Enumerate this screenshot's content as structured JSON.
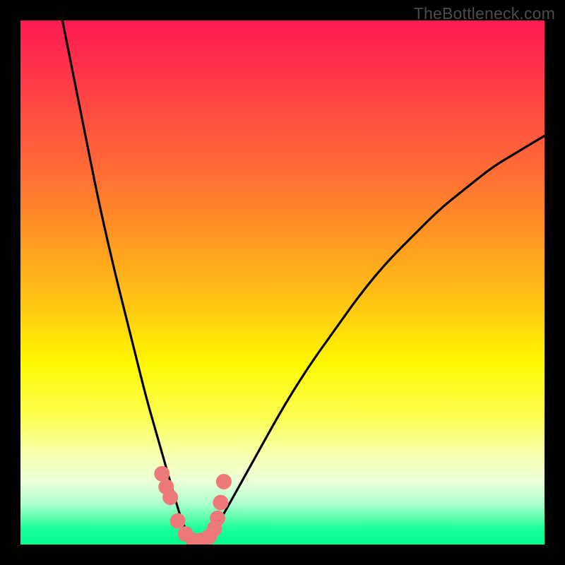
{
  "watermark": "TheBottleneck.com",
  "colors": {
    "frame_bg_top": "#ff1a52",
    "frame_bg_bottom": "#00ff90",
    "stroke": "#000000",
    "markers": "#ed7a79",
    "page_bg": "#000000",
    "watermark_text": "#4c4c4c"
  },
  "chart_data": {
    "type": "line",
    "title": "",
    "xlabel": "",
    "ylabel": "",
    "xlim": [
      0,
      100
    ],
    "ylim": [
      0,
      100
    ],
    "grid": false,
    "legend": false,
    "series": [
      {
        "name": "bottleneck-curve",
        "description": "V-shaped performance-match curve; minimum near x≈33 where bottleneck≈0, rising steeply toward both ends.",
        "x": [
          8,
          10,
          12,
          15,
          18,
          20,
          22,
          24,
          26,
          28,
          30,
          31,
          32,
          33,
          34,
          35,
          36,
          37,
          38,
          40,
          45,
          50,
          55,
          60,
          65,
          70,
          75,
          80,
          85,
          90,
          95,
          100
        ],
        "values": [
          100,
          90,
          80,
          65,
          52,
          44,
          36,
          28,
          21,
          14,
          7,
          4,
          2,
          0.5,
          0.5,
          1,
          2,
          3,
          4.5,
          8,
          17,
          26,
          34,
          41,
          48,
          54,
          59,
          64,
          68,
          72,
          75,
          78
        ]
      }
    ],
    "markers": {
      "name": "highlight-points-near-minimum",
      "color": "#ed7a79",
      "x": [
        27,
        27.8,
        28.6,
        30,
        31.5,
        33,
        34.5,
        36,
        37,
        37.6,
        38.2,
        38.8
      ],
      "values": [
        13.5,
        11,
        9,
        4.5,
        2,
        0.8,
        0.8,
        1.5,
        3,
        5,
        8,
        12
      ]
    }
  }
}
